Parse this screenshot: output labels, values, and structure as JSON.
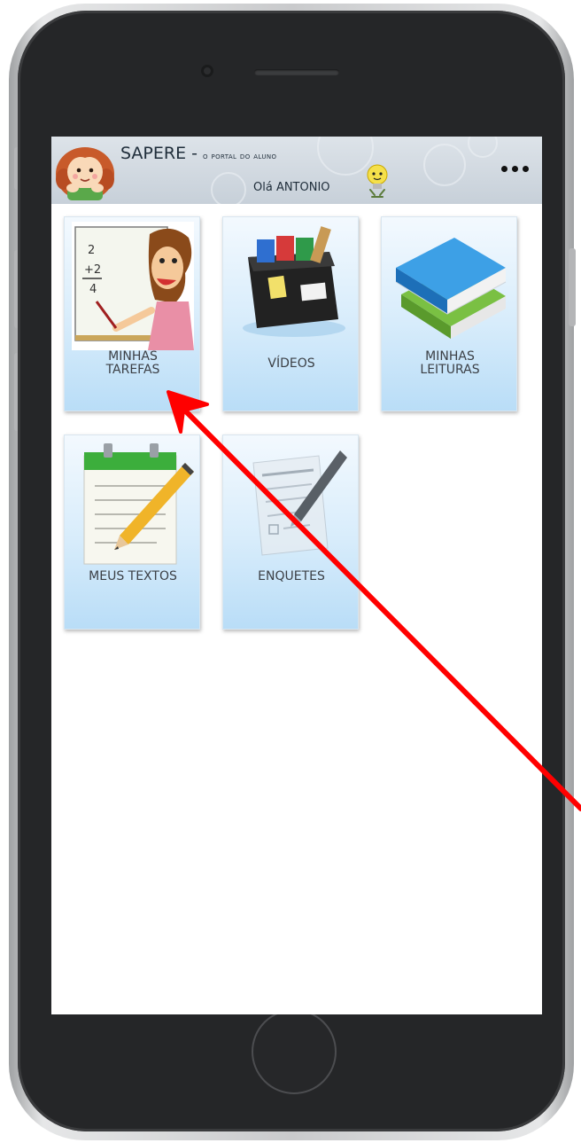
{
  "header": {
    "title": "SAPERE",
    "separator": "-",
    "subtitle": "o portal do aluno",
    "greeting": "Olá ANTONIO",
    "more_label": "more-options"
  },
  "tiles": [
    {
      "label": "MINHAS\nTAREFAS",
      "icon": "teacher-blackboard-icon"
    },
    {
      "label": "VÍDEOS",
      "icon": "video-box-icon"
    },
    {
      "label": "MINHAS\nLEITURAS",
      "icon": "books-stack-icon"
    },
    {
      "label": "MEUS TEXTOS",
      "icon": "notepad-pencil-icon"
    },
    {
      "label": "ENQUETES",
      "icon": "survey-pen-icon"
    }
  ],
  "annotation": {
    "color": "#ff0000",
    "points_to": "tile-minhas-tarefas"
  }
}
